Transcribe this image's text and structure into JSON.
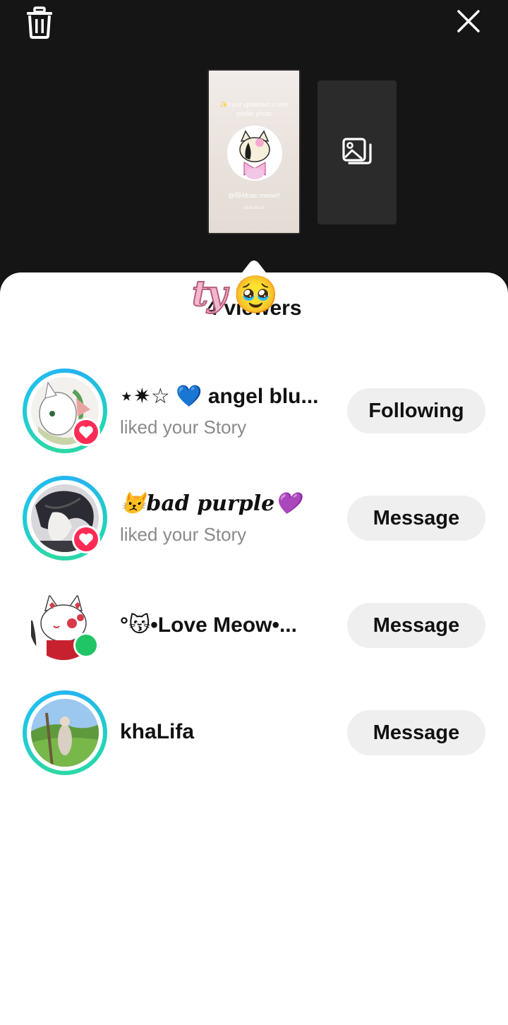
{
  "toolbar": {
    "delete_icon": "trash-icon",
    "close_icon": "close-icon"
  },
  "story_thumbnail": {
    "caption": "✨I just uploaded a new profile photo",
    "tag": "@😾Afnan meow!!",
    "date": "2024-06-01"
  },
  "add_story_icon": "image-stack-icon",
  "sheet": {
    "title": "4 viewers",
    "sticker_text": "ty",
    "sticker_emoji": "🥹"
  },
  "viewers": [
    {
      "name": "⋆✷☆ 💙 angel blu...",
      "activity": "liked your Story",
      "badge": "heart",
      "action": "Following"
    },
    {
      "name": "😾bad purple💜",
      "activity": "liked your Story",
      "badge": "heart",
      "action": "Message"
    },
    {
      "name": "°😽•Love Meow•...",
      "activity": "",
      "badge": "online",
      "action": "Message"
    },
    {
      "name": "khaLifa",
      "activity": "",
      "badge": "",
      "action": "Message"
    }
  ],
  "colors": {
    "like_red": "#fe2c55",
    "online_green": "#20c565",
    "ring_teal": "#1dc6e8"
  }
}
